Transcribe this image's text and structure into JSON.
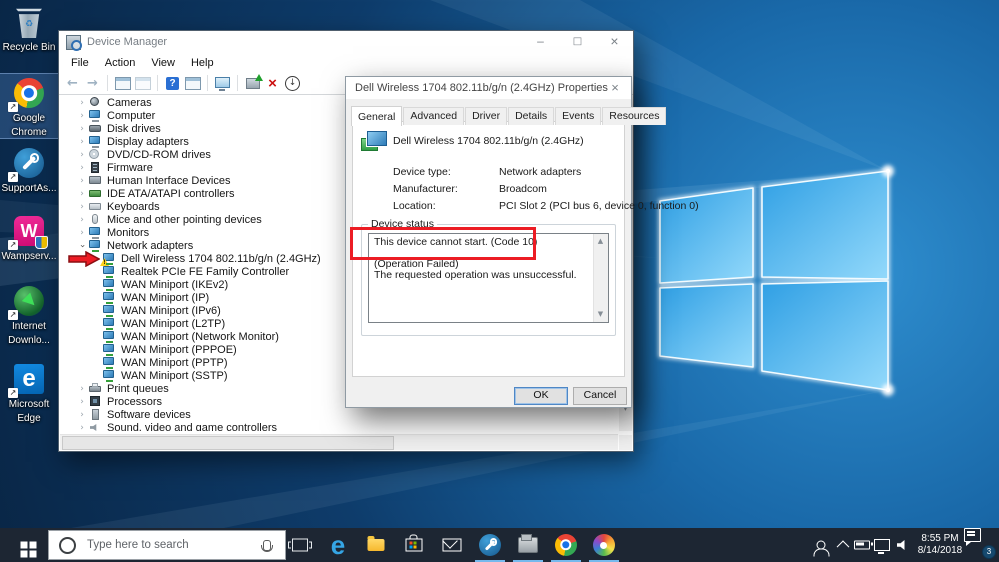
{
  "desktop": {
    "icons": [
      {
        "name": "recycle-bin",
        "label": "Recycle Bin",
        "label2": "",
        "selected": false
      },
      {
        "name": "google-chrome",
        "label": "Google",
        "label2": "Chrome",
        "selected": true
      },
      {
        "name": "supportassist",
        "label": "SupportAs...",
        "label2": "",
        "selected": false
      },
      {
        "name": "wampserver",
        "label": "Wampserv...",
        "label2": "",
        "selected": false
      },
      {
        "name": "internet-download-manager",
        "label": "Internet",
        "label2": "Downlo...",
        "selected": false
      },
      {
        "name": "microsoft-edge",
        "label": "Microsoft",
        "label2": "Edge",
        "selected": false
      }
    ]
  },
  "device_manager": {
    "title": "Device Manager",
    "window_controls": [
      "minimize",
      "maximize",
      "close"
    ],
    "menu": [
      "File",
      "Action",
      "View",
      "Help"
    ],
    "toolbar": [
      "back",
      "forward",
      "sep",
      "console-window",
      "console-window-2",
      "sep",
      "help",
      "show-properties-window",
      "sep",
      "scan-hardware",
      "sep",
      "update-driver",
      "uninstall-device",
      "disable-device"
    ],
    "tree": [
      {
        "label": "Cameras",
        "level": 0,
        "state": "collapsed",
        "icon": "camera"
      },
      {
        "label": "Computer",
        "level": 0,
        "state": "collapsed",
        "icon": "computer"
      },
      {
        "label": "Disk drives",
        "level": 0,
        "state": "collapsed",
        "icon": "disk"
      },
      {
        "label": "Display adapters",
        "level": 0,
        "state": "collapsed",
        "icon": "display"
      },
      {
        "label": "DVD/CD-ROM drives",
        "level": 0,
        "state": "collapsed",
        "icon": "dvd"
      },
      {
        "label": "Firmware",
        "level": 0,
        "state": "collapsed",
        "icon": "firmware"
      },
      {
        "label": "Human Interface Devices",
        "level": 0,
        "state": "collapsed",
        "icon": "hid"
      },
      {
        "label": "IDE ATA/ATAPI controllers",
        "level": 0,
        "state": "collapsed",
        "icon": "ide"
      },
      {
        "label": "Keyboards",
        "level": 0,
        "state": "collapsed",
        "icon": "keyboard"
      },
      {
        "label": "Mice and other pointing devices",
        "level": 0,
        "state": "collapsed",
        "icon": "mouse"
      },
      {
        "label": "Monitors",
        "level": 0,
        "state": "collapsed",
        "icon": "monitor"
      },
      {
        "label": "Network adapters",
        "level": 0,
        "state": "expanded",
        "icon": "network"
      },
      {
        "label": "Dell Wireless 1704 802.11b/g/n (2.4GHz)",
        "level": 1,
        "state": "none",
        "icon": "netadapter",
        "warning": true,
        "arrow": true
      },
      {
        "label": "Realtek PCIe FE Family Controller",
        "level": 1,
        "state": "none",
        "icon": "netadapter"
      },
      {
        "label": "WAN Miniport (IKEv2)",
        "level": 1,
        "state": "none",
        "icon": "netadapter"
      },
      {
        "label": "WAN Miniport (IP)",
        "level": 1,
        "state": "none",
        "icon": "netadapter"
      },
      {
        "label": "WAN Miniport (IPv6)",
        "level": 1,
        "state": "none",
        "icon": "netadapter"
      },
      {
        "label": "WAN Miniport (L2TP)",
        "level": 1,
        "state": "none",
        "icon": "netadapter"
      },
      {
        "label": "WAN Miniport (Network Monitor)",
        "level": 1,
        "state": "none",
        "icon": "netadapter"
      },
      {
        "label": "WAN Miniport (PPPOE)",
        "level": 1,
        "state": "none",
        "icon": "netadapter"
      },
      {
        "label": "WAN Miniport (PPTP)",
        "level": 1,
        "state": "none",
        "icon": "netadapter"
      },
      {
        "label": "WAN Miniport (SSTP)",
        "level": 1,
        "state": "none",
        "icon": "netadapter"
      },
      {
        "label": "Print queues",
        "level": 0,
        "state": "collapsed",
        "icon": "print"
      },
      {
        "label": "Processors",
        "level": 0,
        "state": "collapsed",
        "icon": "processor"
      },
      {
        "label": "Software devices",
        "level": 0,
        "state": "collapsed",
        "icon": "software"
      },
      {
        "label": "Sound, video and game controllers",
        "level": 0,
        "state": "collapsed",
        "icon": "sound"
      }
    ]
  },
  "dialog": {
    "title": "Dell Wireless 1704 802.11b/g/n (2.4GHz) Properties",
    "tabs": [
      "General",
      "Advanced",
      "Driver",
      "Details",
      "Events",
      "Resources"
    ],
    "active_tab": "General",
    "device_name": "Dell Wireless 1704 802.11b/g/n (2.4GHz)",
    "fields": [
      {
        "label": "Device type:",
        "value": "Network adapters"
      },
      {
        "label": "Manufacturer:",
        "value": "Broadcom"
      },
      {
        "label": "Location:",
        "value": "PCI Slot 2 (PCI bus 6, device 0, function 0)"
      }
    ],
    "group_label": "Device status",
    "status_lines": [
      "This device cannot start. (Code 10)",
      "",
      "(Operation Failed)",
      "The requested operation was unsuccessful."
    ],
    "ok": "OK",
    "cancel": "Cancel"
  },
  "annotations": {
    "highlight_color": "#ec1c24",
    "highlighted_text": "This device cannot start. (Code 10)",
    "arrow_target": "Dell Wireless 1704 802.11b/g/n (2.4GHz)"
  },
  "taskbar": {
    "search": {
      "placeholder": "Type here to search"
    },
    "icons": [
      "task-view",
      "edge",
      "file-explorer",
      "store",
      "mail",
      "supportassist",
      "device-tool",
      "chrome",
      "paint"
    ],
    "running": [
      "supportassist",
      "device-tool",
      "chrome",
      "paint"
    ],
    "tray": {
      "icons": [
        "people",
        "chevron-up",
        "battery",
        "network-display",
        "volume"
      ],
      "time": "8:55 PM",
      "date": "8/14/2018",
      "notification_count": "3"
    }
  },
  "colors": {
    "accent": "#0078d7",
    "taskbar": "#1d2633",
    "annotation": "#ec1c24",
    "wallpaper_bright": "#4db2f0",
    "wallpaper_dark": "#092646"
  }
}
